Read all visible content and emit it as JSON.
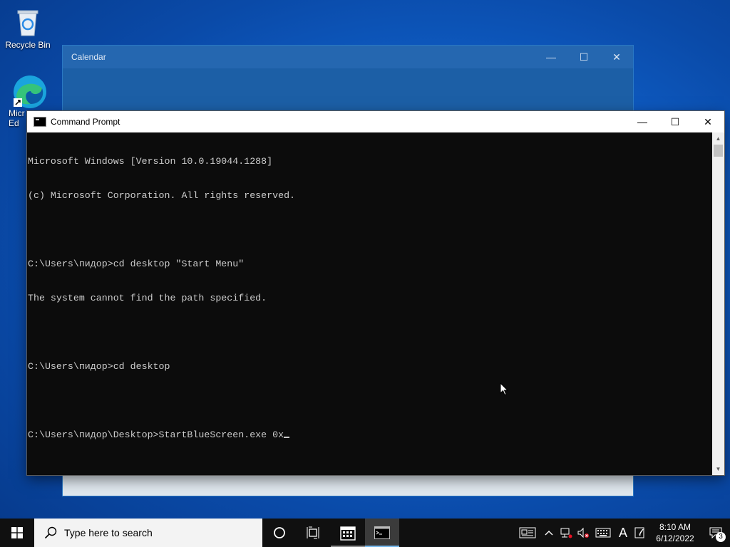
{
  "desktop": {
    "icons": [
      {
        "label": "Recycle Bin",
        "icon": "recycle-bin-icon"
      },
      {
        "label": "Micr\nEd",
        "icon": "edge-icon"
      }
    ]
  },
  "calendar_window": {
    "title": "Calendar",
    "controls": {
      "minimize": "—",
      "maximize": "☐",
      "close": "✕"
    }
  },
  "cmd_window": {
    "title": "Command Prompt",
    "controls": {
      "minimize": "—",
      "maximize": "☐",
      "close": "✕"
    },
    "lines": [
      "Microsoft Windows [Version 10.0.19044.1288]",
      "(c) Microsoft Corporation. All rights reserved.",
      "",
      "C:\\Users\\пидор>cd desktop \"Start Menu\"",
      "The system cannot find the path specified.",
      "",
      "C:\\Users\\пидор>cd desktop",
      "",
      "C:\\Users\\пидор\\Desktop>StartBlueScreen.exe 0x"
    ]
  },
  "taskbar": {
    "search_placeholder": "Type here to search",
    "pinned": [
      "task-view",
      "widgets",
      "calendar",
      "command-prompt"
    ],
    "clock": {
      "time": "8:10 AM",
      "date": "6/12/2022"
    },
    "notifications_count": "3",
    "ime_label": "A"
  },
  "colors": {
    "desktop": "#0f5fc8",
    "console_bg": "#0c0c0c",
    "console_fg": "#cccccc",
    "taskbar": "#101010",
    "accent": "#76b9ed"
  }
}
